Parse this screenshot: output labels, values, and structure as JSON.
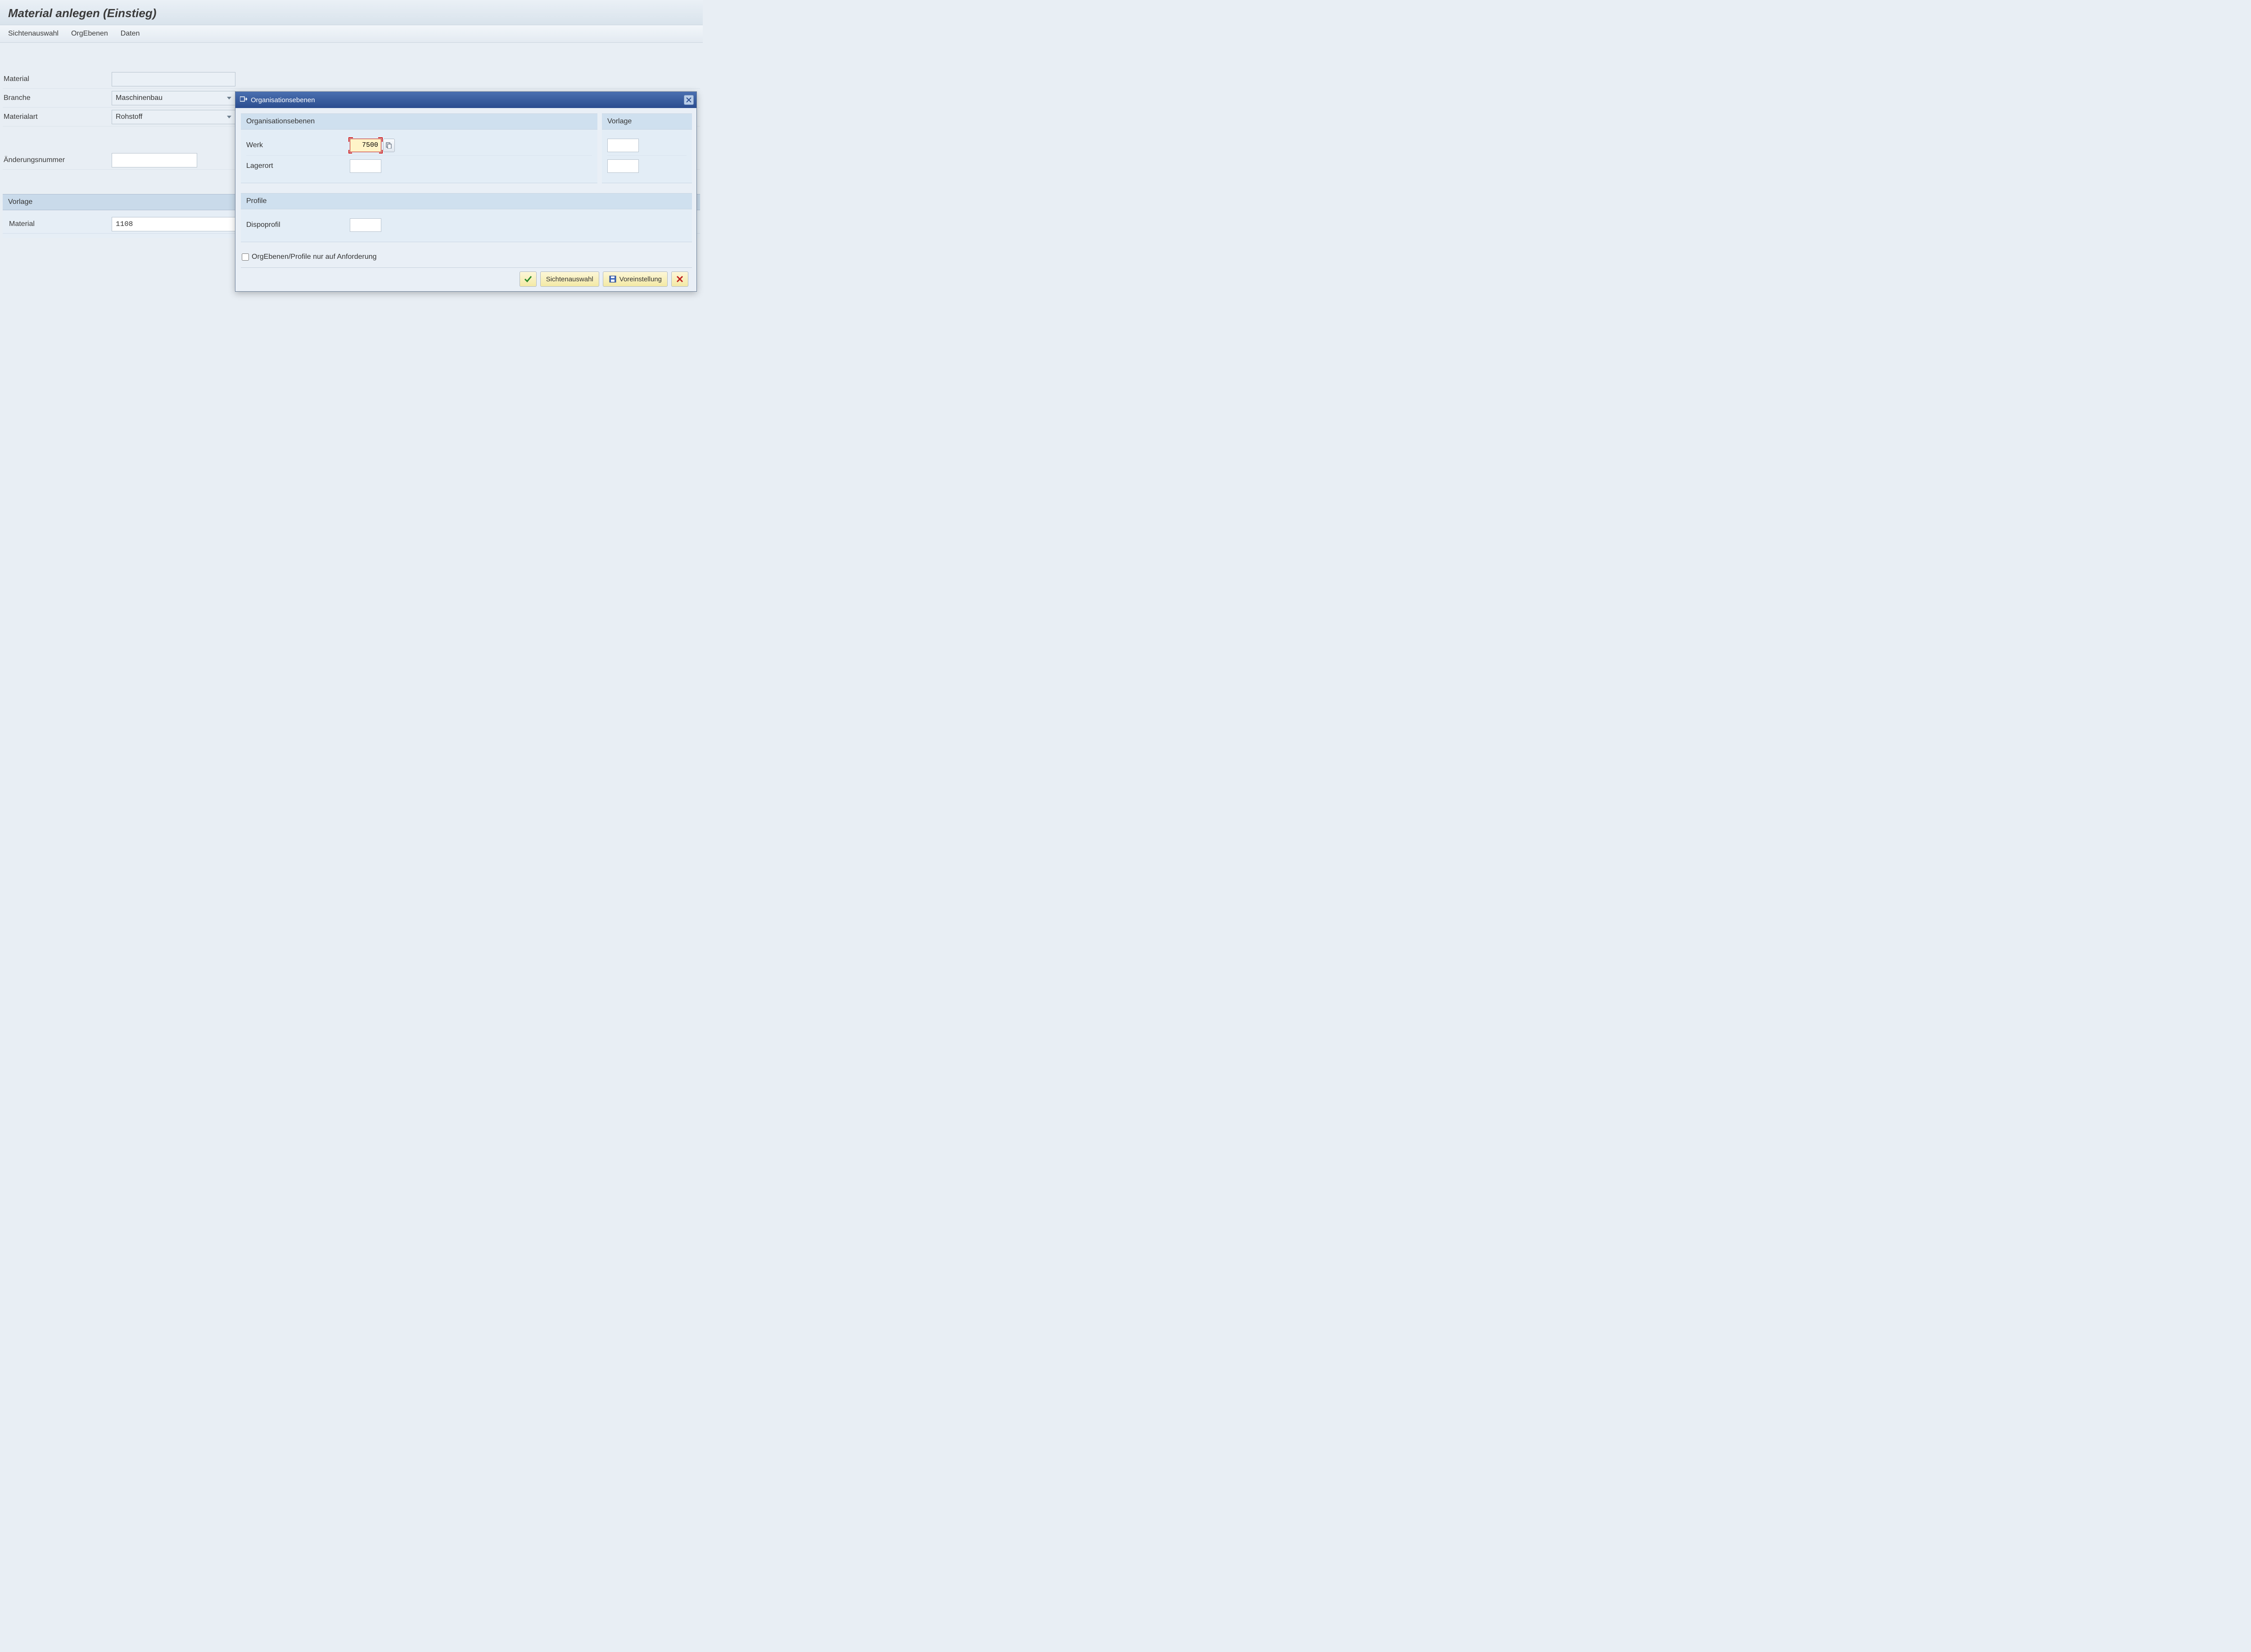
{
  "page_title": "Material anlegen (Einstieg)",
  "toolbar": {
    "sichtenauswahl": "Sichtenauswahl",
    "orgebenen": "OrgEbenen",
    "daten": "Daten"
  },
  "form": {
    "material_label": "Material",
    "material_value": "",
    "branche_label": "Branche",
    "branche_value": "Maschinenbau",
    "materialart_label": "Materialart",
    "materialart_value": "Rohstoff",
    "aenderungsnummer_label": "Änderungsnummer",
    "aenderungsnummer_value": ""
  },
  "vorlage_section": {
    "header": "Vorlage",
    "material_label": "Material",
    "material_value": "1108"
  },
  "dialog": {
    "title": "Organisationsebenen",
    "org_group_header": "Organisationsebenen",
    "vorlage_group_header": "Vorlage",
    "werk_label": "Werk",
    "werk_value": "7500",
    "lagerort_label": "Lagerort",
    "lagerort_value": "",
    "profile_group_header": "Profile",
    "dispoprofil_label": "Dispoprofil",
    "dispoprofil_value": "",
    "checkbox_label": "OrgEbenen/Profile nur auf Anforderung",
    "checkbox_checked": false,
    "buttons": {
      "sichtenauswahl": "Sichtenauswahl",
      "voreinstellung": "Voreinstellung"
    }
  }
}
